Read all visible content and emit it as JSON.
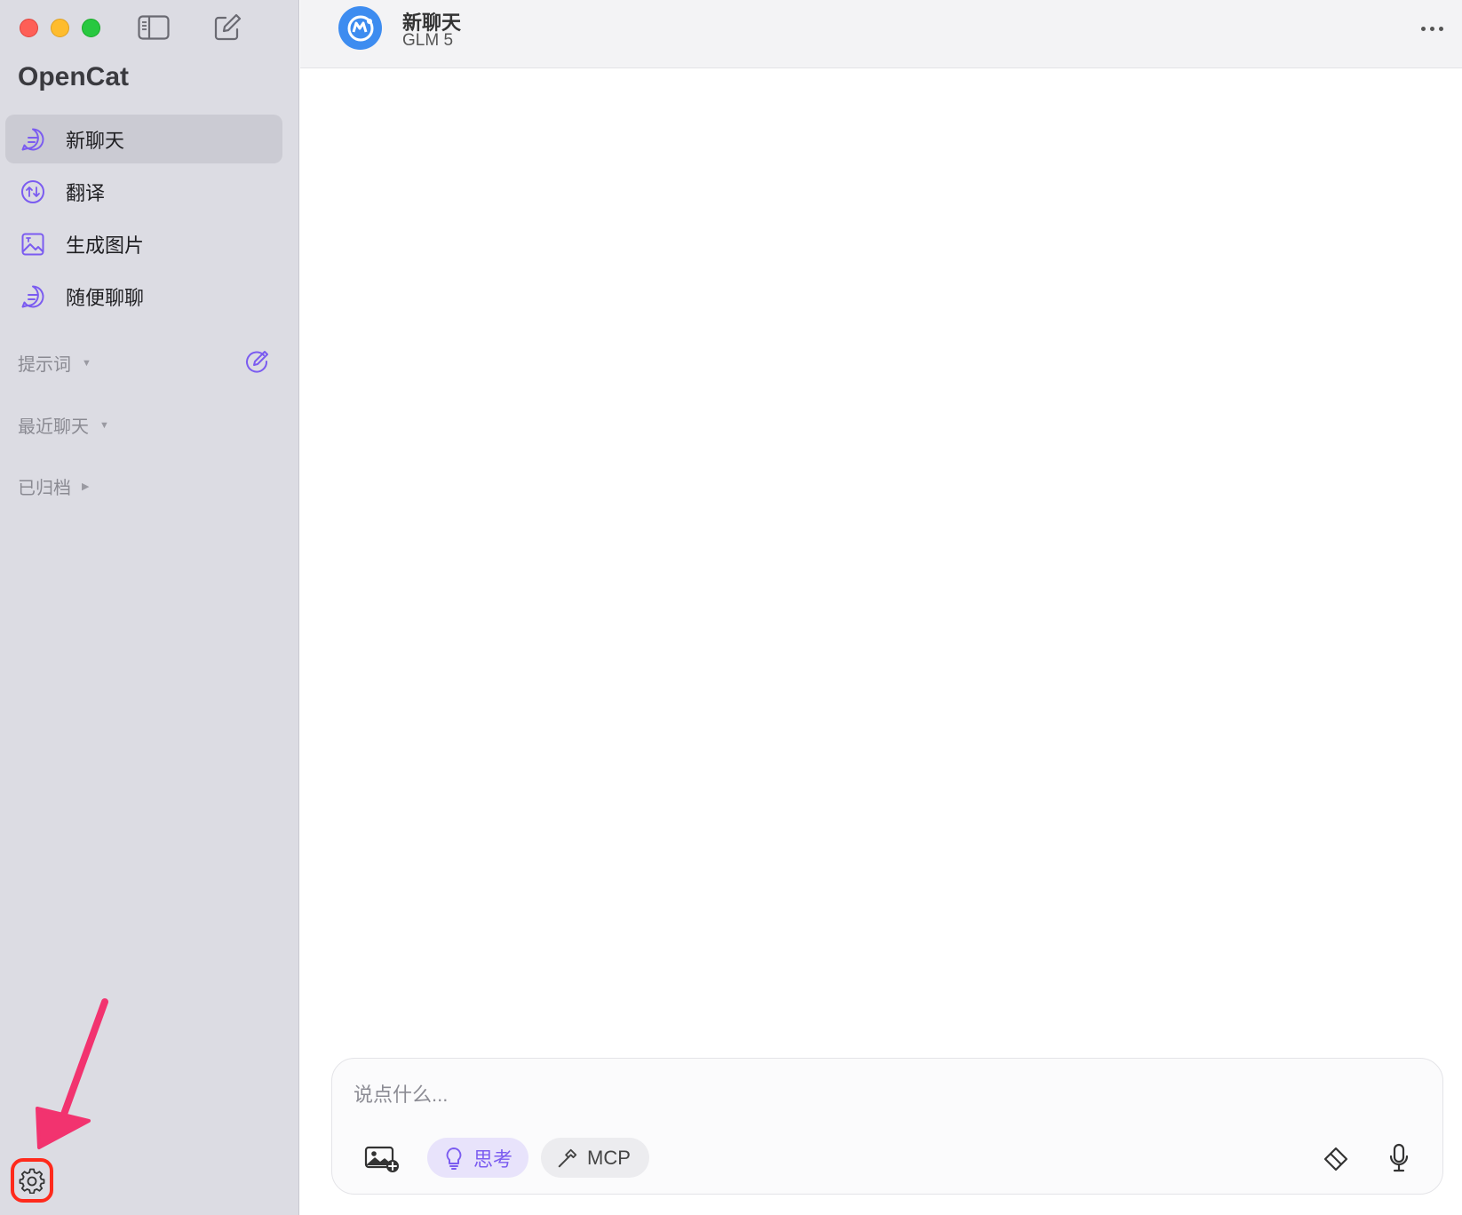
{
  "app": {
    "name": "OpenCat"
  },
  "sidebar": {
    "items": [
      {
        "label": "新聊天",
        "icon": "chat-bubble-icon",
        "active": true
      },
      {
        "label": "翻译",
        "icon": "translate-icon",
        "active": false
      },
      {
        "label": "生成图片",
        "icon": "image-icon",
        "active": false
      },
      {
        "label": "随便聊聊",
        "icon": "chat-bubble-icon",
        "active": false
      }
    ],
    "sections": [
      {
        "label": "提示词",
        "caret": "▼"
      },
      {
        "label": "最近聊天",
        "caret": "▼"
      },
      {
        "label": "已归档",
        "caret": "▶"
      }
    ]
  },
  "header": {
    "title": "新聊天",
    "model": "GLM 5"
  },
  "composer": {
    "placeholder": "说点什么...",
    "think_label": "思考",
    "mcp_label": "MCP"
  },
  "colors": {
    "accent": "#7b5cf0",
    "sidebar_bg": "#dcdce3",
    "highlight_red": "#ff2a1c",
    "arrow_pink": "#f2336f"
  }
}
